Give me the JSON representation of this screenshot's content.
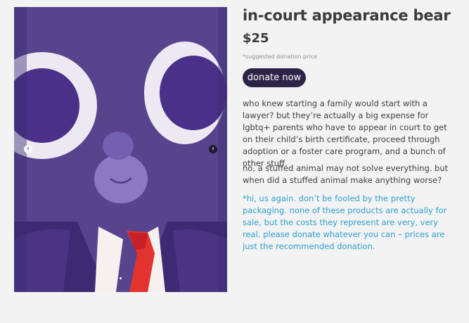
{
  "product": {
    "title": "in-court appearance bear",
    "price": "$25",
    "price_note": "*suggested donation price",
    "donate_label": "donate now",
    "description": [
      "who knew starting a family would start with a lawyer? but they’re actually a big expense for lgbtq+ parents who have to appear in court to get on their child’s birth certificate, proceed through adoption or a foster care program, and a bunch of other stuff.",
      "no, a stuffed animal may not solve everything. but when did a stuffed animal make anything worse?",
      "*hi, us again. don’t be fooled by the pretty packaging. none of these products are actually for sale, but the costs they represent are very, very real. please donate whatever you can – prices are just the recommended donation."
    ]
  },
  "gallery": {
    "prev_icon": "‹",
    "next_icon": "›",
    "thumbnail_count": 3
  },
  "colors": {
    "button": "#2d2448",
    "disclaimer": "#2e9fd0",
    "plush": "#5b4790",
    "felt_white": "#e8e3f0",
    "tie": "#e2332e"
  }
}
